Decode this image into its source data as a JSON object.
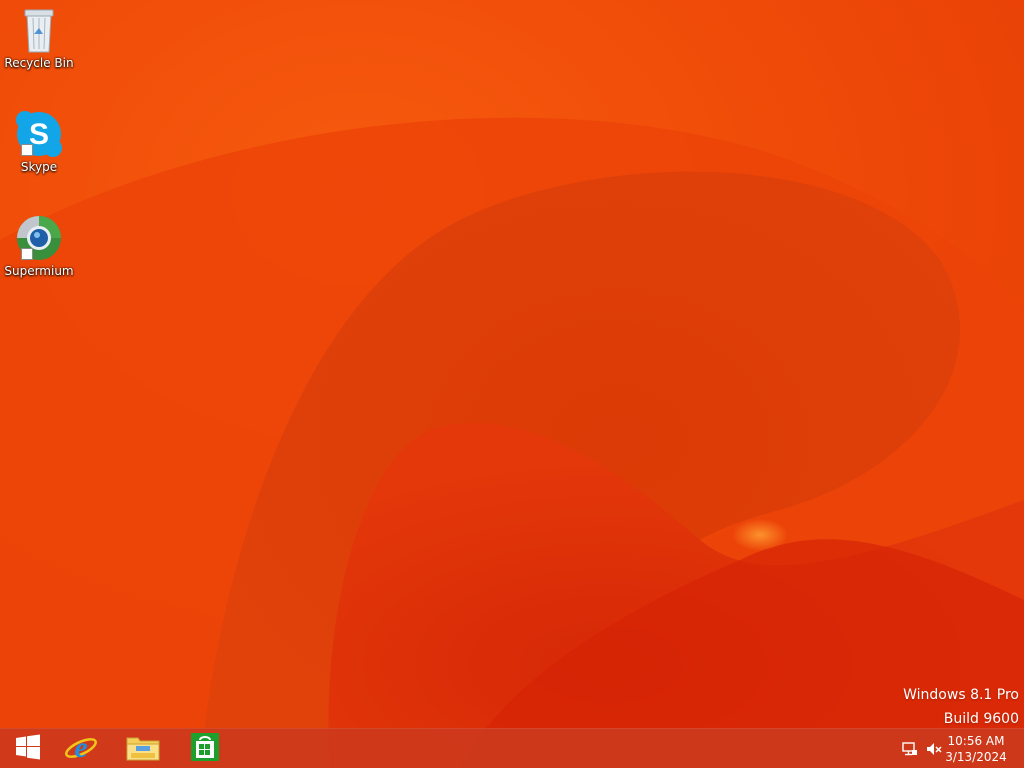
{
  "desktop": {
    "icons": [
      {
        "label": "Recycle Bin",
        "icon": "recycle-bin-icon"
      },
      {
        "label": "Skype",
        "icon": "skype-icon"
      },
      {
        "label": "Supermium",
        "icon": "supermium-icon"
      }
    ]
  },
  "watermark": {
    "edition": "Windows 8.1 Pro",
    "build": "Build 9600"
  },
  "taskbar": {
    "pinned": [
      {
        "name": "Start",
        "icon": "windows-logo-icon"
      },
      {
        "name": "Internet Explorer",
        "icon": "internet-explorer-icon"
      },
      {
        "name": "File Explorer",
        "icon": "file-explorer-icon"
      },
      {
        "name": "Store",
        "icon": "store-icon"
      }
    ],
    "tray": {
      "icons": [
        "network-icon",
        "volume-muted-icon"
      ],
      "time": "10:56 AM",
      "date": "3/13/2024"
    }
  },
  "colors": {
    "wallpaper_base": "#ee4a08",
    "wallpaper_dark": "#d22a08",
    "taskbar": "#cd3a1c",
    "skype_blue": "#12a5e8",
    "store_green": "#1e9e2c",
    "ie_blue": "#1e8fe0"
  }
}
